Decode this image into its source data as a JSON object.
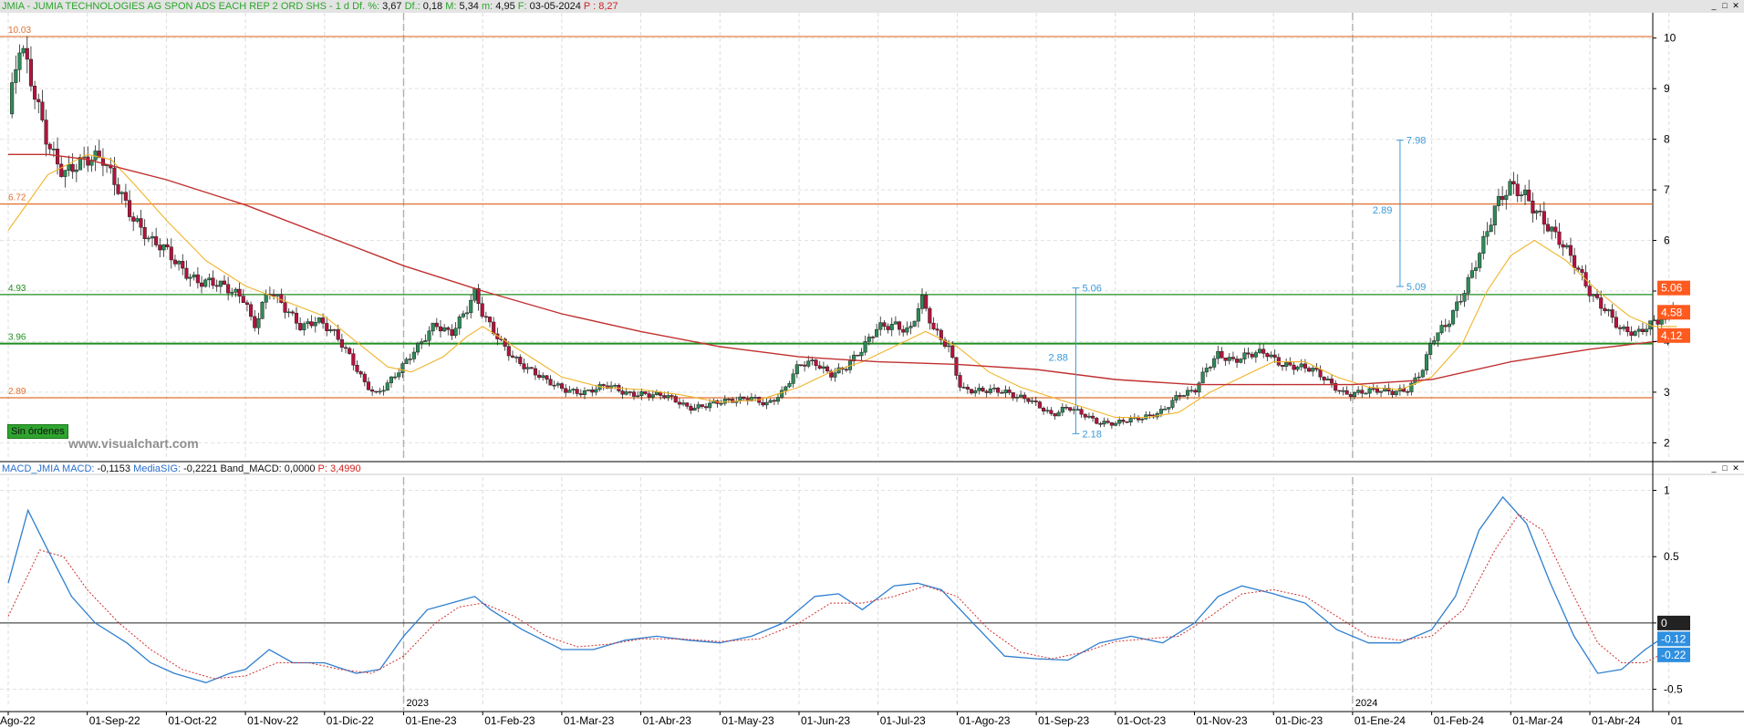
{
  "price_panel": {
    "header": {
      "name": "JMIA - JUMIA TECHNOLOGIES AG SPON ADS EACH REP 2 ORD SHS - 1 d",
      "diff_pct_label": "Df. %:",
      "diff_pct": "3,67",
      "diff_label": "Df.:",
      "diff": "0,18",
      "max_label": "M:",
      "max": "5,34",
      "min_label": "m:",
      "min": "4,95",
      "date_label": "F:",
      "date": "03-05-2024",
      "price_label": "P :",
      "price": "8,27"
    },
    "orders_button": "Sin órdenes",
    "watermark": "www.visualchart.com"
  },
  "macd_panel": {
    "header": {
      "name": "MACD_JMIA",
      "macd_label": "MACD:",
      "macd": "-0,1153",
      "sig_label": "MediaSIG:",
      "sig": "-0,2221",
      "band_label": "Band_MACD:",
      "band": "0,0000",
      "p_label": "P:",
      "p": "3,4990"
    }
  },
  "window_controls": [
    "_",
    "□",
    "✕"
  ],
  "colors": {
    "up_candle": "#2e8b57",
    "down_candle": "#b5123c",
    "ma_short": "#f0b429",
    "ma_long": "#c03030",
    "support_line": "#1e8e1e",
    "resistance_line": "#e07030",
    "macd": "#2f7fd0",
    "signal": "#d03030",
    "measure": "#3a9ad9"
  },
  "chart_data": {
    "type": "candlestick",
    "x_ticks": [
      "Ago-22",
      "01-Sep-22",
      "01-Oct-22",
      "01-Nov-22",
      "01-Dic-22",
      "01-Ene-23",
      "01-Feb-23",
      "01-Mar-23",
      "01-Abr-23",
      "01-May-23",
      "01-Jun-23",
      "01-Jul-23",
      "01-Ago-23",
      "01-Sep-23",
      "01-Oct-23",
      "01-Nov-23",
      "01-Dic-23",
      "01-Ene-24",
      "01-Feb-24",
      "01-Mar-24",
      "01-Abr-24",
      "01"
    ],
    "year_labels": [
      {
        "label": "2023",
        "index": 5
      },
      {
        "label": "2024",
        "index": 17
      }
    ],
    "price_axis": {
      "ylim": [
        1.7,
        10.5
      ],
      "ticks": [
        2,
        3,
        4,
        5,
        6,
        7,
        8,
        9,
        10
      ]
    },
    "horizontal_levels": [
      {
        "value": 10.03,
        "label": "10.03",
        "kind": "resistance"
      },
      {
        "value": 6.72,
        "label": "6.72",
        "kind": "resistance"
      },
      {
        "value": 4.93,
        "label": "4.93",
        "kind": "support"
      },
      {
        "value": 3.96,
        "label": "3.96",
        "kind": "support"
      },
      {
        "value": 2.89,
        "label": "2.89",
        "kind": "resistance"
      }
    ],
    "price_tags": [
      {
        "value": 5.06,
        "label": "5.06"
      },
      {
        "value": 4.58,
        "label": "4.58"
      },
      {
        "value": 4.12,
        "label": "4.12"
      }
    ],
    "measurements": [
      {
        "month": 13.5,
        "from": 2.18,
        "to": 5.06,
        "diff_label": "2.88",
        "from_label": "2.18",
        "to_label": "5.06"
      },
      {
        "month": 17.6,
        "from": 5.09,
        "to": 7.98,
        "diff_label": "2.89",
        "from_label": "5.09",
        "to_label": "7.98"
      }
    ],
    "close_path": [
      [
        0,
        8.5
      ],
      [
        0.15,
        9.8
      ],
      [
        0.3,
        9.0
      ],
      [
        0.5,
        8.0
      ],
      [
        0.7,
        7.4
      ],
      [
        1.0,
        7.5
      ],
      [
        1.2,
        7.6
      ],
      [
        1.4,
        7.1
      ],
      [
        1.6,
        6.4
      ],
      [
        1.8,
        5.9
      ],
      [
        2.0,
        5.8
      ],
      [
        2.2,
        5.5
      ],
      [
        2.4,
        5.2
      ],
      [
        2.6,
        5.1
      ],
      [
        2.8,
        5.0
      ],
      [
        3.0,
        4.9
      ],
      [
        3.1,
        4.3
      ],
      [
        3.2,
        4.7
      ],
      [
        3.3,
        5.0
      ],
      [
        3.5,
        4.6
      ],
      [
        3.7,
        4.3
      ],
      [
        3.9,
        4.5
      ],
      [
        4.1,
        4.2
      ],
      [
        4.3,
        3.7
      ],
      [
        4.5,
        3.2
      ],
      [
        4.65,
        3.0
      ],
      [
        4.8,
        3.2
      ],
      [
        5.0,
        3.5
      ],
      [
        5.2,
        3.9
      ],
      [
        5.4,
        4.4
      ],
      [
        5.6,
        4.2
      ],
      [
        5.8,
        4.6
      ],
      [
        5.9,
        4.9
      ],
      [
        6.0,
        4.5
      ],
      [
        6.2,
        4.1
      ],
      [
        6.4,
        3.7
      ],
      [
        6.6,
        3.4
      ],
      [
        6.8,
        3.2
      ],
      [
        7.0,
        3.1
      ],
      [
        7.3,
        3.0
      ],
      [
        7.6,
        3.1
      ],
      [
        7.8,
        3.0
      ],
      [
        8.0,
        3.0
      ],
      [
        8.3,
        2.9
      ],
      [
        8.6,
        2.7
      ],
      [
        8.9,
        2.8
      ],
      [
        9.2,
        2.8
      ],
      [
        9.4,
        2.9
      ],
      [
        9.6,
        2.8
      ],
      [
        9.8,
        3.0
      ],
      [
        10.0,
        3.5
      ],
      [
        10.2,
        3.6
      ],
      [
        10.4,
        3.4
      ],
      [
        10.6,
        3.5
      ],
      [
        10.8,
        3.8
      ],
      [
        11.0,
        4.3
      ],
      [
        11.2,
        4.4
      ],
      [
        11.4,
        4.2
      ],
      [
        11.55,
        4.8
      ],
      [
        11.7,
        4.2
      ],
      [
        11.9,
        3.9
      ],
      [
        12.05,
        3.1
      ],
      [
        12.3,
        3.0
      ],
      [
        12.6,
        3.0
      ],
      [
        12.9,
        2.9
      ],
      [
        13.2,
        2.5
      ],
      [
        13.4,
        2.7
      ],
      [
        13.6,
        2.6
      ],
      [
        13.8,
        2.4
      ],
      [
        14.0,
        2.35
      ],
      [
        14.2,
        2.45
      ],
      [
        14.4,
        2.55
      ],
      [
        14.6,
        2.65
      ],
      [
        14.8,
        2.9
      ],
      [
        15.0,
        3.0
      ],
      [
        15.15,
        3.5
      ],
      [
        15.3,
        3.8
      ],
      [
        15.5,
        3.6
      ],
      [
        15.7,
        3.7
      ],
      [
        15.9,
        3.8
      ],
      [
        16.1,
        3.6
      ],
      [
        16.3,
        3.5
      ],
      [
        16.5,
        3.4
      ],
      [
        16.7,
        3.2
      ],
      [
        16.9,
        3.0
      ],
      [
        17.2,
        3.0
      ],
      [
        17.5,
        3.0
      ],
      [
        17.7,
        3.1
      ],
      [
        17.9,
        3.5
      ],
      [
        18.0,
        4.0
      ],
      [
        18.2,
        4.3
      ],
      [
        18.4,
        5.0
      ],
      [
        18.6,
        5.8
      ],
      [
        18.8,
        6.6
      ],
      [
        19.0,
        7.0
      ],
      [
        19.2,
        6.9
      ],
      [
        19.4,
        6.5
      ],
      [
        19.6,
        6.0
      ],
      [
        19.8,
        5.5
      ],
      [
        20.0,
        5.0
      ],
      [
        20.2,
        4.7
      ],
      [
        20.4,
        4.2
      ],
      [
        20.6,
        4.1
      ],
      [
        20.8,
        4.4
      ],
      [
        21.0,
        4.6
      ],
      [
        21.1,
        4.95
      ]
    ],
    "series": [
      {
        "name": "",
        "values": [
          [
            0,
            6.2
          ],
          [
            0.5,
            7.3
          ],
          [
            1.0,
            7.7
          ],
          [
            1.3,
            7.6
          ],
          [
            1.6,
            7.1
          ],
          [
            2.0,
            6.4
          ],
          [
            2.5,
            5.6
          ],
          [
            3.0,
            5.1
          ],
          [
            3.5,
            4.8
          ],
          [
            4.0,
            4.5
          ],
          [
            4.4,
            4.0
          ],
          [
            4.8,
            3.5
          ],
          [
            5.1,
            3.4
          ],
          [
            5.5,
            3.7
          ],
          [
            5.8,
            4.1
          ],
          [
            6.0,
            4.3
          ],
          [
            6.3,
            4.0
          ],
          [
            6.7,
            3.6
          ],
          [
            7.0,
            3.3
          ],
          [
            7.5,
            3.1
          ],
          [
            8.0,
            3.05
          ],
          [
            8.5,
            2.95
          ],
          [
            9.0,
            2.8
          ],
          [
            9.5,
            2.85
          ],
          [
            10.0,
            3.1
          ],
          [
            10.4,
            3.4
          ],
          [
            10.8,
            3.6
          ],
          [
            11.2,
            3.9
          ],
          [
            11.6,
            4.2
          ],
          [
            12.0,
            3.9
          ],
          [
            12.4,
            3.4
          ],
          [
            12.8,
            3.1
          ],
          [
            13.2,
            2.9
          ],
          [
            13.6,
            2.7
          ],
          [
            14.0,
            2.5
          ],
          [
            14.4,
            2.5
          ],
          [
            14.8,
            2.6
          ],
          [
            15.2,
            3.0
          ],
          [
            15.6,
            3.3
          ],
          [
            16.0,
            3.6
          ],
          [
            16.4,
            3.6
          ],
          [
            16.8,
            3.3
          ],
          [
            17.2,
            3.1
          ],
          [
            17.6,
            3.05
          ],
          [
            18.0,
            3.3
          ],
          [
            18.4,
            4.0
          ],
          [
            18.7,
            5.0
          ],
          [
            19.0,
            5.7
          ],
          [
            19.3,
            6.0
          ],
          [
            19.7,
            5.6
          ],
          [
            20.1,
            5.0
          ],
          [
            20.5,
            4.5
          ],
          [
            20.8,
            4.3
          ],
          [
            21.1,
            4.3
          ]
        ]
      },
      {
        "name": "",
        "values": [
          [
            0,
            7.7
          ],
          [
            0.5,
            7.7
          ],
          [
            1.0,
            7.6
          ],
          [
            1.5,
            7.4
          ],
          [
            2.0,
            7.2
          ],
          [
            3.0,
            6.7
          ],
          [
            4.0,
            6.1
          ],
          [
            5.0,
            5.5
          ],
          [
            6.0,
            5.0
          ],
          [
            7.0,
            4.55
          ],
          [
            8.0,
            4.2
          ],
          [
            9.0,
            3.9
          ],
          [
            10.0,
            3.7
          ],
          [
            11.0,
            3.6
          ],
          [
            12.0,
            3.55
          ],
          [
            13.0,
            3.45
          ],
          [
            14.0,
            3.25
          ],
          [
            15.0,
            3.15
          ],
          [
            16.0,
            3.15
          ],
          [
            17.0,
            3.15
          ],
          [
            18.0,
            3.25
          ],
          [
            19.0,
            3.6
          ],
          [
            20.0,
            3.85
          ],
          [
            21.1,
            4.05
          ]
        ]
      }
    ],
    "macd_axis": {
      "ylim": [
        -0.62,
        1.1
      ],
      "ticks": [
        -0.5,
        0,
        0.5,
        1
      ]
    },
    "macd_tags": [
      {
        "value": 0,
        "label": "0"
      },
      {
        "value": -0.12,
        "label": "-0.12"
      },
      {
        "value": -0.22,
        "label": "-0.22"
      }
    ],
    "macd_series": [
      {
        "name": "MACD",
        "values": [
          [
            0,
            0.3
          ],
          [
            0.25,
            0.85
          ],
          [
            0.5,
            0.55
          ],
          [
            0.8,
            0.2
          ],
          [
            1.1,
            0.0
          ],
          [
            1.5,
            -0.15
          ],
          [
            1.8,
            -0.3
          ],
          [
            2.1,
            -0.38
          ],
          [
            2.5,
            -0.45
          ],
          [
            2.8,
            -0.38
          ],
          [
            3.0,
            -0.35
          ],
          [
            3.3,
            -0.2
          ],
          [
            3.6,
            -0.3
          ],
          [
            4.0,
            -0.3
          ],
          [
            4.4,
            -0.38
          ],
          [
            4.7,
            -0.35
          ],
          [
            5.0,
            -0.1
          ],
          [
            5.3,
            0.1
          ],
          [
            5.6,
            0.15
          ],
          [
            5.9,
            0.2
          ],
          [
            6.1,
            0.1
          ],
          [
            6.5,
            -0.05
          ],
          [
            7.0,
            -0.2
          ],
          [
            7.4,
            -0.2
          ],
          [
            7.8,
            -0.13
          ],
          [
            8.2,
            -0.1
          ],
          [
            8.6,
            -0.13
          ],
          [
            9.0,
            -0.15
          ],
          [
            9.4,
            -0.1
          ],
          [
            9.8,
            -0.0
          ],
          [
            10.2,
            0.2
          ],
          [
            10.5,
            0.22
          ],
          [
            10.8,
            0.1
          ],
          [
            11.2,
            0.28
          ],
          [
            11.5,
            0.3
          ],
          [
            11.8,
            0.25
          ],
          [
            12.2,
            0.0
          ],
          [
            12.6,
            -0.25
          ],
          [
            13.0,
            -0.27
          ],
          [
            13.4,
            -0.28
          ],
          [
            13.8,
            -0.15
          ],
          [
            14.2,
            -0.1
          ],
          [
            14.6,
            -0.15
          ],
          [
            15.0,
            -0.0
          ],
          [
            15.3,
            0.2
          ],
          [
            15.6,
            0.28
          ],
          [
            16.0,
            0.22
          ],
          [
            16.4,
            0.15
          ],
          [
            16.8,
            -0.05
          ],
          [
            17.2,
            -0.15
          ],
          [
            17.6,
            -0.15
          ],
          [
            18.0,
            -0.05
          ],
          [
            18.3,
            0.2
          ],
          [
            18.6,
            0.7
          ],
          [
            18.9,
            0.95
          ],
          [
            19.2,
            0.75
          ],
          [
            19.5,
            0.3
          ],
          [
            19.8,
            -0.1
          ],
          [
            20.1,
            -0.38
          ],
          [
            20.4,
            -0.35
          ],
          [
            20.7,
            -0.2
          ],
          [
            20.9,
            -0.12
          ]
        ]
      },
      {
        "name": "MediaSIG",
        "values": [
          [
            0,
            0.05
          ],
          [
            0.4,
            0.55
          ],
          [
            0.7,
            0.5
          ],
          [
            1.0,
            0.25
          ],
          [
            1.4,
            0.0
          ],
          [
            1.8,
            -0.2
          ],
          [
            2.2,
            -0.35
          ],
          [
            2.6,
            -0.42
          ],
          [
            3.0,
            -0.4
          ],
          [
            3.4,
            -0.3
          ],
          [
            3.8,
            -0.3
          ],
          [
            4.2,
            -0.35
          ],
          [
            4.6,
            -0.38
          ],
          [
            5.0,
            -0.25
          ],
          [
            5.4,
            0.0
          ],
          [
            5.7,
            0.12
          ],
          [
            6.0,
            0.15
          ],
          [
            6.4,
            0.05
          ],
          [
            6.8,
            -0.1
          ],
          [
            7.2,
            -0.18
          ],
          [
            7.6,
            -0.16
          ],
          [
            8.0,
            -0.12
          ],
          [
            8.5,
            -0.12
          ],
          [
            9.0,
            -0.14
          ],
          [
            9.5,
            -0.12
          ],
          [
            10.0,
            0.0
          ],
          [
            10.4,
            0.15
          ],
          [
            10.8,
            0.15
          ],
          [
            11.2,
            0.2
          ],
          [
            11.6,
            0.28
          ],
          [
            12.0,
            0.2
          ],
          [
            12.4,
            -0.05
          ],
          [
            12.8,
            -0.22
          ],
          [
            13.2,
            -0.27
          ],
          [
            13.6,
            -0.22
          ],
          [
            14.0,
            -0.14
          ],
          [
            14.4,
            -0.12
          ],
          [
            14.8,
            -0.1
          ],
          [
            15.2,
            0.05
          ],
          [
            15.6,
            0.22
          ],
          [
            16.0,
            0.25
          ],
          [
            16.4,
            0.2
          ],
          [
            16.8,
            0.05
          ],
          [
            17.2,
            -0.1
          ],
          [
            17.6,
            -0.13
          ],
          [
            18.0,
            -0.1
          ],
          [
            18.4,
            0.1
          ],
          [
            18.8,
            0.55
          ],
          [
            19.1,
            0.82
          ],
          [
            19.4,
            0.7
          ],
          [
            19.8,
            0.2
          ],
          [
            20.1,
            -0.15
          ],
          [
            20.4,
            -0.3
          ],
          [
            20.7,
            -0.3
          ],
          [
            20.95,
            -0.22
          ]
        ]
      }
    ]
  }
}
